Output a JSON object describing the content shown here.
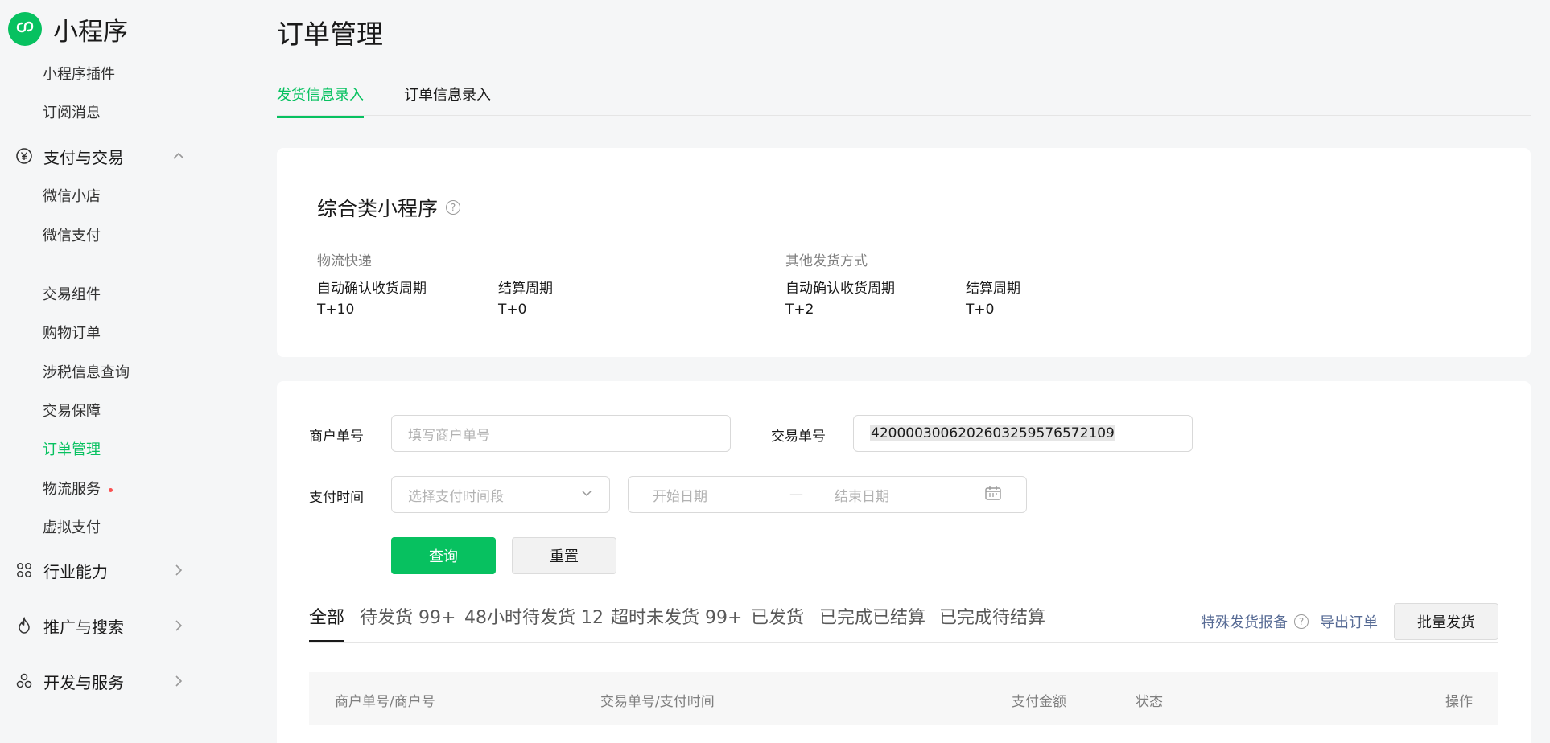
{
  "app": {
    "name": "小程序"
  },
  "sidebar": {
    "items": [
      {
        "label": "小程序插件"
      },
      {
        "label": "订阅消息"
      },
      {
        "label": "支付与交易"
      },
      {
        "label": "微信小店"
      },
      {
        "label": "微信支付"
      },
      {
        "label": "交易组件"
      },
      {
        "label": "购物订单"
      },
      {
        "label": "涉税信息查询"
      },
      {
        "label": "交易保障"
      },
      {
        "label": "订单管理"
      },
      {
        "label": "物流服务"
      },
      {
        "label": "虚拟支付"
      },
      {
        "label": "行业能力"
      },
      {
        "label": "推广与搜索"
      },
      {
        "label": "开发与服务"
      }
    ]
  },
  "page": {
    "title": "订单管理",
    "tabs": [
      {
        "label": "发货信息录入"
      },
      {
        "label": "订单信息录入"
      }
    ]
  },
  "summary": {
    "title": "综合类小程序",
    "logistics": {
      "category": "物流快递",
      "auto_confirm_label": "自动确认收货周期",
      "auto_confirm_value": "T+10",
      "settle_label": "结算周期",
      "settle_value": "T+0"
    },
    "other": {
      "category": "其他发货方式",
      "auto_confirm_label": "自动确认收货周期",
      "auto_confirm_value": "T+2",
      "settle_label": "结算周期",
      "settle_value": "T+0"
    }
  },
  "filters": {
    "merchant_label": "商户单号",
    "merchant_placeholder": "填写商户单号",
    "trade_label": "交易单号",
    "trade_value": "4200003006202603259576572109",
    "pay_time_label": "支付时间",
    "pay_time_placeholder": "选择支付时间段",
    "start_date_placeholder": "开始日期",
    "date_separator": "—",
    "end_date_placeholder": "结束日期",
    "query_button": "查询",
    "reset_button": "重置"
  },
  "status_tabs": [
    {
      "label": "全部"
    },
    {
      "label": "待发货 99+"
    },
    {
      "label": "48小时待发货 12"
    },
    {
      "label": "超时未发货 99+"
    },
    {
      "label": "已发货"
    },
    {
      "label": "已完成已结算"
    },
    {
      "label": "已完成待结算"
    }
  ],
  "actions": {
    "special_report": "特殊发货报备",
    "export": "导出订单",
    "batch_ship": "批量发货"
  },
  "table": {
    "columns": [
      "商户单号/商户号",
      "交易单号/支付时间",
      "支付金额",
      "状态",
      "操作"
    ]
  },
  "colors": {
    "accent": "#07c160",
    "link": "#576b95",
    "alert": "#fa5151"
  },
  "icons": {
    "logo": "miniprogram-logo-icon",
    "payment": "yen-circle-icon",
    "industry": "industry-icon",
    "promotion": "flame-icon",
    "dev": "dev-service-icon",
    "calendar": "calendar-icon"
  }
}
